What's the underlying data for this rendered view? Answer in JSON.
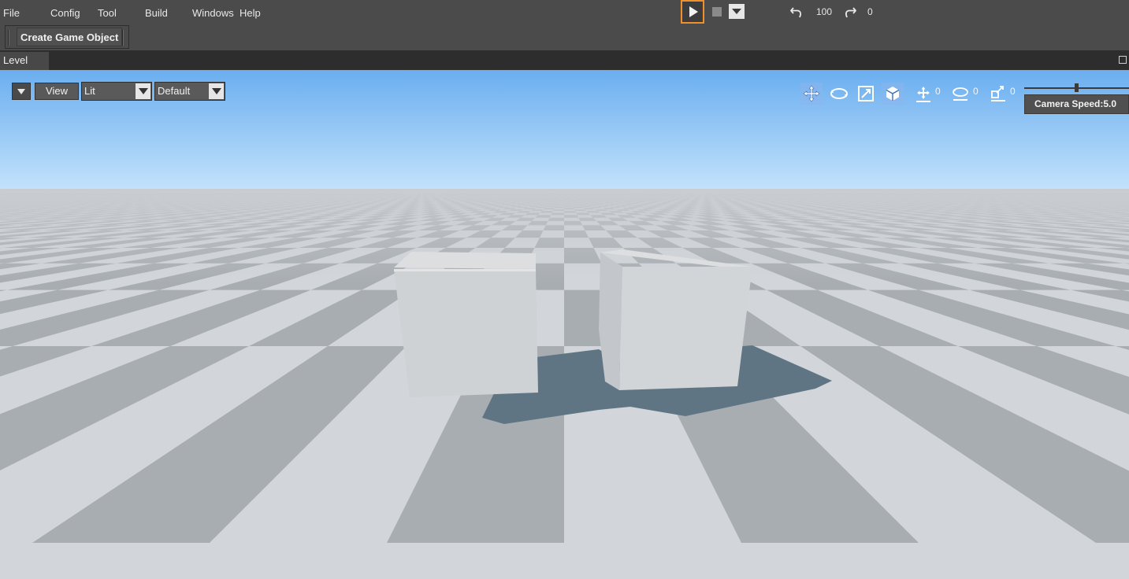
{
  "menubar": {
    "items": [
      "File",
      "Config",
      "Tool",
      "Build",
      "Windows",
      "Help"
    ]
  },
  "play_controls": {
    "play_icon": "play-icon",
    "stop_icon": "stop-icon",
    "dropdown_icon": "chevron-down-icon",
    "accent_color": "#f0902a"
  },
  "history": {
    "undo_icon": "undo-icon",
    "undo_count": "100",
    "redo_icon": "redo-icon",
    "redo_count": "0"
  },
  "toolbar": {
    "create_game_object_label": "Create Game Object"
  },
  "tabs": {
    "level_label": "Level"
  },
  "viewport": {
    "view_label": "View",
    "shading_mode": "Lit",
    "camera_preset": "Default",
    "gizmos": [
      {
        "name": "translate-gizmo-icon",
        "active": true
      },
      {
        "name": "rotate-gizmo-icon",
        "active": false
      },
      {
        "name": "scale-gizmo-icon",
        "active": false
      },
      {
        "name": "universal-gizmo-icon",
        "active": true
      }
    ],
    "snap": {
      "translate_snap": "0",
      "rotate_snap": "0",
      "scale_snap": "0"
    },
    "camera_speed_label": "Camera Speed:5.0",
    "camera_speed": 5.0,
    "scene_objects": [
      "cube",
      "cube"
    ],
    "sky_color_top": "#6aaef0",
    "sky_color_horizon": "#c3e2fb"
  }
}
